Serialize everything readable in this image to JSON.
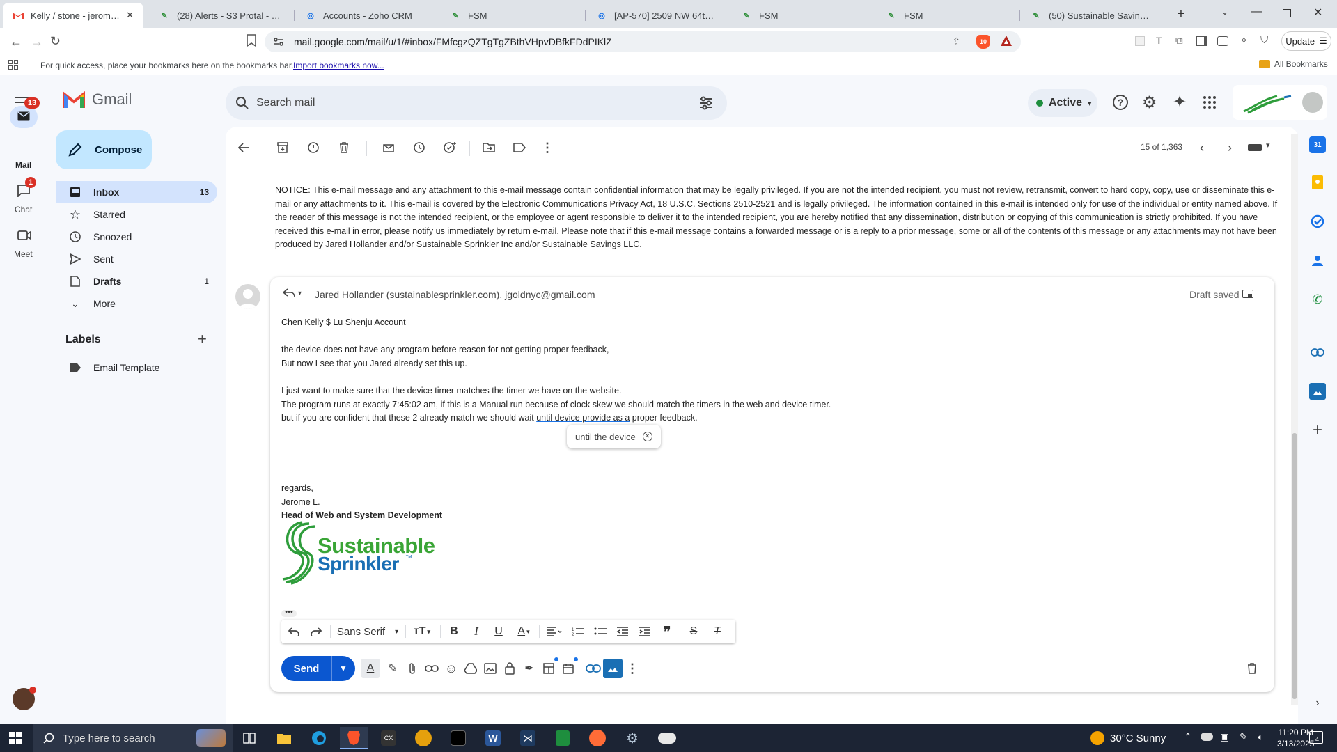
{
  "browser": {
    "tabs": [
      {
        "title": "Kelly / stone - jerome@s…",
        "active": true
      },
      {
        "title": "(28) Alerts - S3 Protal - Tasks"
      },
      {
        "title": "Accounts - Zoho CRM"
      },
      {
        "title": "FSM"
      },
      {
        "title": "[AP-570] 2509 NW 64th Blvd"
      },
      {
        "title": "FSM"
      },
      {
        "title": "FSM"
      },
      {
        "title": "(50) Sustainable Savings, LLC"
      }
    ],
    "url": "mail.google.com/mail/u/1/#inbox/FMfcgzQZTgTgZBthVHpvDBfkFDdPIKlZ",
    "update_label": "Update",
    "bookmarks_msg": "For quick access, place your bookmarks here on the bookmarks bar.",
    "import_link": "Import bookmarks now...",
    "all_bookmarks": "All Bookmarks",
    "shield_count": "10"
  },
  "gmail": {
    "logo_text": "Gmail",
    "search_placeholder": "Search mail",
    "status": "Active",
    "rail": [
      {
        "label": "Mail",
        "badge": "13"
      },
      {
        "label": "Chat",
        "badge": "1"
      },
      {
        "label": "Meet"
      }
    ],
    "compose": "Compose",
    "nav": [
      {
        "label": "Inbox",
        "count": "13"
      },
      {
        "label": "Starred"
      },
      {
        "label": "Snoozed"
      },
      {
        "label": "Sent"
      },
      {
        "label": "Drafts",
        "count": "1"
      },
      {
        "label": "More"
      }
    ],
    "labels_title": "Labels",
    "labels": [
      "Email Template"
    ],
    "pagination": "15 of 1,363"
  },
  "message": {
    "notice": "NOTICE: This e-mail message and any attachment to this e-mail message contain confidential information that may be legally privileged. If you are not the intended recipient, you must not review, retransmit, convert to hard copy, copy, use or disseminate this e-mail or any attachments to it. This e-mail is covered by the Electronic Communications Privacy Act, 18 U.S.C. Sections 2510-2521 and is legally privileged. The information contained in this e-mail is intended only for use of the individual or entity named above. If the reader of this message is not the intended recipient, or the employee or agent responsible to deliver it to the intended recipient, you are hereby notified that any dissemination, distribution or copying of this communication is strictly prohibited. If you have received this e-mail in error, please notify us immediately by return e-mail. Please note that if this e-mail message contains a forwarded message or is a reply to a prior message, some or all of the contents of this message or any attachments may not have been produced by Jared Hollander and/or Sustainable Sprinkler Inc and/or Sustainable Savings LLC."
  },
  "reply": {
    "recipients_prefix": "Jared Hollander (sustainablesprinkler.com), ",
    "recipients_link": "jgoldnyc@gmail.com",
    "draft_status": "Draft saved",
    "subject_line": "Chen Kelly $ Lu Shenju Account",
    "body1_line1": "the device does not have any program before reason for not getting proper feedback,",
    "body1_line2": "But now I see that you Jared already set this up.",
    "body2_line1": "I just want to make sure that the device timer matches the timer we have on the website.",
    "body2_line2": "The program runs at exactly 7:45:02 am,  if this is a Manual run because of clock skew we should match the timers in the web and device timer.",
    "body2_line3_a": "but if you are confident that these 2 already match we should wait ",
    "body2_line3_b": "until device provide as a",
    "body2_line3_c": " proper feedback.",
    "suggestion": "until the device",
    "sig_regards": "regards,",
    "sig_name": "Jerome L.",
    "sig_title": "Head of Web and System Development",
    "logo_line1": "Sustainable",
    "logo_line2": "Sprinkler",
    "logo_tm": "™",
    "font_select": "Sans Serif",
    "send": "Send"
  },
  "taskbar": {
    "search_placeholder": "Type here to search",
    "weather": "30°C  Sunny",
    "time": "11:20 PM",
    "date": "3/13/2025",
    "notif_count": "4"
  },
  "colors": {
    "accent": "#0b57d0",
    "inbox_bg": "#d3e3fd",
    "compose_bg": "#c2e7ff",
    "badge": "#d93025",
    "brand_green": "#3aa536",
    "brand_blue": "#1a6fb4"
  }
}
